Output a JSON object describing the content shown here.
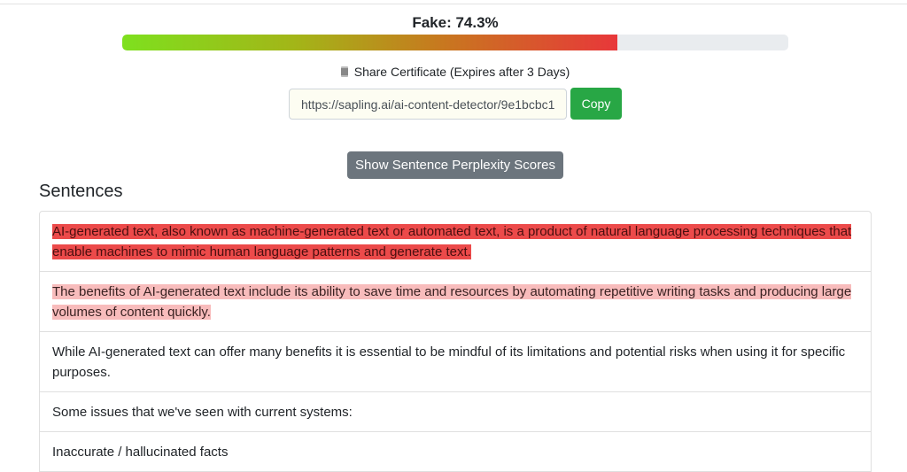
{
  "score": {
    "label": "Fake: 74.3%",
    "fraction": 0.743,
    "bar_colors": [
      "#7ee01e",
      "#e8373a"
    ]
  },
  "share": {
    "icon": "scroll-icon",
    "text": "Share Certificate (Expires after 3 Days)",
    "url": "https://sapling.ai/ai-content-detector/9e1bcbc1c",
    "copy_label": "Copy"
  },
  "perplexity_button": "Show Sentence Perplexity Scores",
  "sentences_heading": "Sentences",
  "sentences": [
    {
      "text": "AI-generated text, also known as machine-generated text or automated text, is a product of natural language processing techniques that enable machines to mimic human language patterns and generate text.",
      "highlight": "high"
    },
    {
      "text": "The benefits of AI-generated text include its ability to save time and resources by automating repetitive writing tasks and producing large volumes of content quickly.",
      "highlight": "mid"
    },
    {
      "text": "While AI-generated text can offer many benefits it is essential to be mindful of its limitations and potential risks when using it for specific purposes.",
      "highlight": "none"
    },
    {
      "text": "Some issues that we've seen with current systems:",
      "highlight": "none"
    },
    {
      "text": "Inaccurate / hallucinated facts",
      "highlight": "none"
    }
  ]
}
